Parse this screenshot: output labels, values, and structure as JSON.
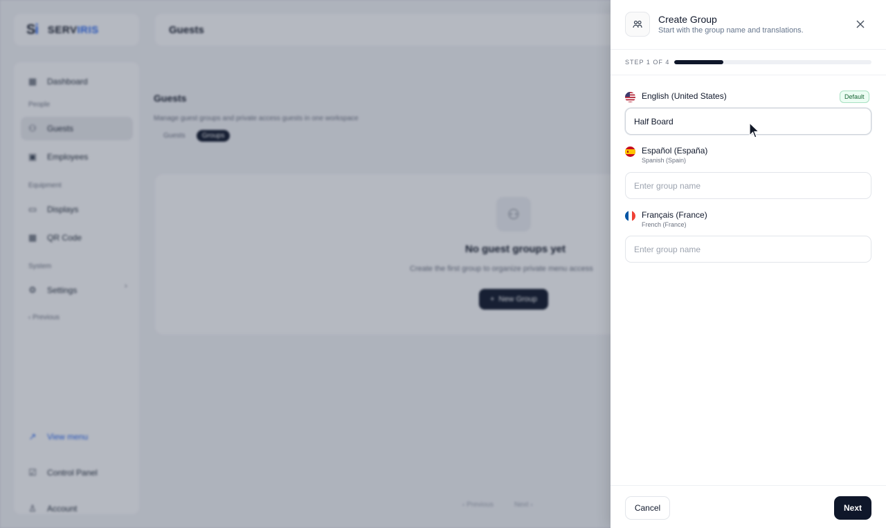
{
  "background": {
    "logo_mark": "S",
    "logo_mark_accent": "i",
    "logo_text": "SERV",
    "logo_text_accent": "IRIS",
    "topbar_title": "Guests",
    "sidebar": {
      "items": [
        {
          "label": "Dashboard",
          "icon": "grid-icon"
        },
        {
          "section": "People"
        },
        {
          "label": "Guests",
          "icon": "users-icon",
          "active": true
        },
        {
          "label": "Employees",
          "icon": "briefcase-icon"
        },
        {
          "section": "Equipment"
        },
        {
          "label": "Displays",
          "icon": "display-icon"
        },
        {
          "label": "QR Code",
          "icon": "qr-icon"
        },
        {
          "section": "System"
        },
        {
          "label": "Settings",
          "icon": "gear-icon"
        }
      ],
      "previous": "‹ Previous",
      "view_menu": "View menu",
      "control_panel": "Control Panel",
      "account": "Account"
    },
    "page_title": "Guests",
    "page_subtitle": "Manage guest groups and private access guests in one workspace",
    "tabs": [
      "Guests",
      "Groups"
    ],
    "active_tab": "Groups",
    "empty_title": "No guest groups yet",
    "empty_desc": "Create the first group to organize private menu access",
    "new_group_label": "New Group",
    "pager": [
      "‹ Previous",
      "Next ›"
    ]
  },
  "drawer": {
    "title": "Create Group",
    "subtitle": "Start with the group name and translations.",
    "icon": "users-icon",
    "step_label": "STEP 1 OF 4",
    "progress": 0.25,
    "languages": [
      {
        "name": "English (United States)",
        "sub": "",
        "flag": "us-flag",
        "value": "Half Board",
        "placeholder": "Enter group name",
        "default_badge": "Default"
      },
      {
        "name": "Español (España)",
        "sub": "Spanish (Spain)",
        "flag": "es-flag",
        "value": "",
        "placeholder": "Enter group name"
      },
      {
        "name": "Français (France)",
        "sub": "French (France)",
        "flag": "fr-flag",
        "value": "",
        "placeholder": "Enter group name"
      }
    ],
    "cancel_label": "Cancel",
    "next_label": "Next"
  },
  "colors": {
    "primary": "#0f172a",
    "badge_green": "#ecfdf3",
    "link_blue": "#2563eb"
  }
}
